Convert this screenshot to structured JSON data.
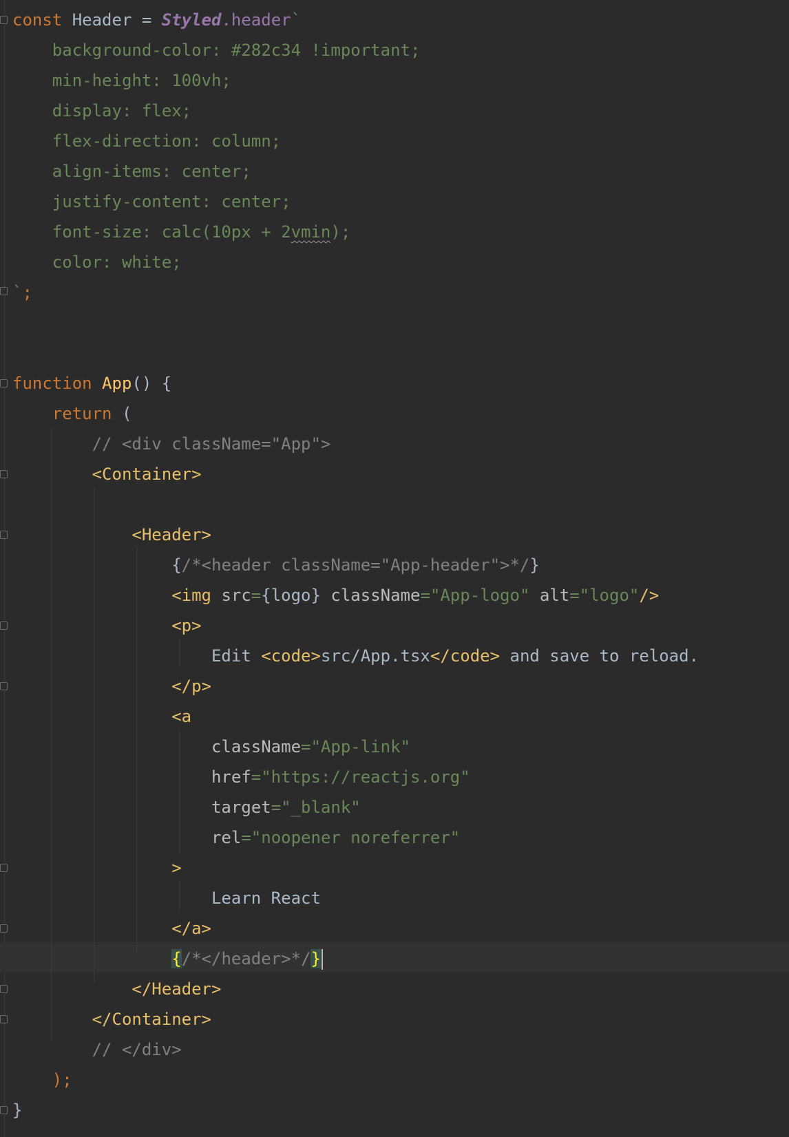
{
  "editor": {
    "lines": [
      {
        "segments": [
          {
            "cls": "kw",
            "t": "const "
          },
          {
            "cls": "id",
            "t": "Header "
          },
          {
            "cls": "id",
            "t": "= "
          },
          {
            "cls": "styled",
            "t": "Styled"
          },
          {
            "cls": "prop",
            "t": ".header"
          },
          {
            "cls": "css",
            "t": "`"
          }
        ]
      },
      {
        "segments": [
          {
            "cls": "css",
            "t": "    background-color: #282c34 !important;"
          }
        ]
      },
      {
        "segments": [
          {
            "cls": "css",
            "t": "    min-height: 100vh;"
          }
        ]
      },
      {
        "segments": [
          {
            "cls": "css",
            "t": "    display: flex;"
          }
        ]
      },
      {
        "segments": [
          {
            "cls": "css",
            "t": "    flex-direction: column;"
          }
        ]
      },
      {
        "segments": [
          {
            "cls": "css",
            "t": "    align-items: center;"
          }
        ]
      },
      {
        "segments": [
          {
            "cls": "css",
            "t": "    justify-content: center;"
          }
        ]
      },
      {
        "segments": [
          {
            "cls": "css",
            "t": "    font-size: calc(10px + 2"
          },
          {
            "cls": "css squiggle",
            "t": "vmin"
          },
          {
            "cls": "css",
            "t": ");"
          }
        ]
      },
      {
        "segments": [
          {
            "cls": "css",
            "t": "    color: white;"
          }
        ]
      },
      {
        "segments": [
          {
            "cls": "css",
            "t": "`"
          },
          {
            "cls": "kw",
            "t": ";"
          }
        ]
      },
      {
        "segments": []
      },
      {
        "segments": []
      },
      {
        "segments": [
          {
            "cls": "kw",
            "t": "function "
          },
          {
            "cls": "fn",
            "t": "App"
          },
          {
            "cls": "id",
            "t": "() {"
          }
        ]
      },
      {
        "segments": [
          {
            "cls": "kw",
            "t": "    return "
          },
          {
            "cls": "id",
            "t": "("
          }
        ]
      },
      {
        "segments": [
          {
            "cls": "cm",
            "t": "        // <div className=\"App\">"
          }
        ]
      },
      {
        "segments": [
          {
            "cls": "tag",
            "t": "        <Container>"
          }
        ]
      },
      {
        "segments": []
      },
      {
        "segments": [
          {
            "cls": "tag",
            "t": "            <Header>"
          }
        ]
      },
      {
        "segments": [
          {
            "cls": "txt",
            "t": "                {"
          },
          {
            "cls": "cm",
            "t": "/*<header className=\"App-header\">*/"
          },
          {
            "cls": "txt",
            "t": "}"
          }
        ]
      },
      {
        "segments": [
          {
            "cls": "tag",
            "t": "                <img "
          },
          {
            "cls": "attr",
            "t": "src"
          },
          {
            "cls": "str",
            "t": "="
          },
          {
            "cls": "txt",
            "t": "{logo} "
          },
          {
            "cls": "attr",
            "t": "className"
          },
          {
            "cls": "str",
            "t": "=\"App-logo\" "
          },
          {
            "cls": "attr",
            "t": "alt"
          },
          {
            "cls": "str",
            "t": "=\"logo\""
          },
          {
            "cls": "tag",
            "t": "/>"
          }
        ]
      },
      {
        "segments": [
          {
            "cls": "tag",
            "t": "                <p>"
          }
        ]
      },
      {
        "segments": [
          {
            "cls": "txt",
            "t": "                    Edit "
          },
          {
            "cls": "tag",
            "t": "<code>"
          },
          {
            "cls": "txt",
            "t": "src/App.tsx"
          },
          {
            "cls": "tag",
            "t": "</code>"
          },
          {
            "cls": "txt",
            "t": " and save to reload."
          }
        ]
      },
      {
        "segments": [
          {
            "cls": "tag",
            "t": "                </p>"
          }
        ]
      },
      {
        "segments": [
          {
            "cls": "tag",
            "t": "                <a"
          }
        ]
      },
      {
        "segments": [
          {
            "cls": "attr",
            "t": "                    className"
          },
          {
            "cls": "str",
            "t": "=\"App-link\""
          }
        ]
      },
      {
        "segments": [
          {
            "cls": "attr",
            "t": "                    href"
          },
          {
            "cls": "str",
            "t": "=\"https://reactjs.org\""
          }
        ]
      },
      {
        "segments": [
          {
            "cls": "attr",
            "t": "                    target"
          },
          {
            "cls": "str",
            "t": "=\"_blank\""
          }
        ]
      },
      {
        "segments": [
          {
            "cls": "attr",
            "t": "                    rel"
          },
          {
            "cls": "str",
            "t": "=\"noopener noreferrer\""
          }
        ]
      },
      {
        "segments": [
          {
            "cls": "tag",
            "t": "                >"
          }
        ]
      },
      {
        "segments": [
          {
            "cls": "txt",
            "t": "                    Learn React"
          }
        ]
      },
      {
        "segments": [
          {
            "cls": "tag",
            "t": "                </a>"
          }
        ]
      },
      {
        "segments": [
          {
            "cls": "txt",
            "t": "                "
          },
          {
            "cls": "brace-hl",
            "t": "{"
          },
          {
            "cls": "cm",
            "t": "/*</header>*/"
          },
          {
            "cls": "brace-hl",
            "t": "}"
          },
          {
            "cls": "caret",
            "t": ""
          }
        ]
      },
      {
        "segments": [
          {
            "cls": "tag",
            "t": "            </Header>"
          }
        ]
      },
      {
        "segments": [
          {
            "cls": "tag",
            "t": "        </Container>"
          }
        ]
      },
      {
        "segments": [
          {
            "cls": "cm",
            "t": "        // </div>"
          }
        ]
      },
      {
        "segments": [
          {
            "cls": "kw",
            "t": "    );"
          }
        ]
      },
      {
        "segments": [
          {
            "cls": "id",
            "t": "}"
          }
        ]
      }
    ]
  }
}
